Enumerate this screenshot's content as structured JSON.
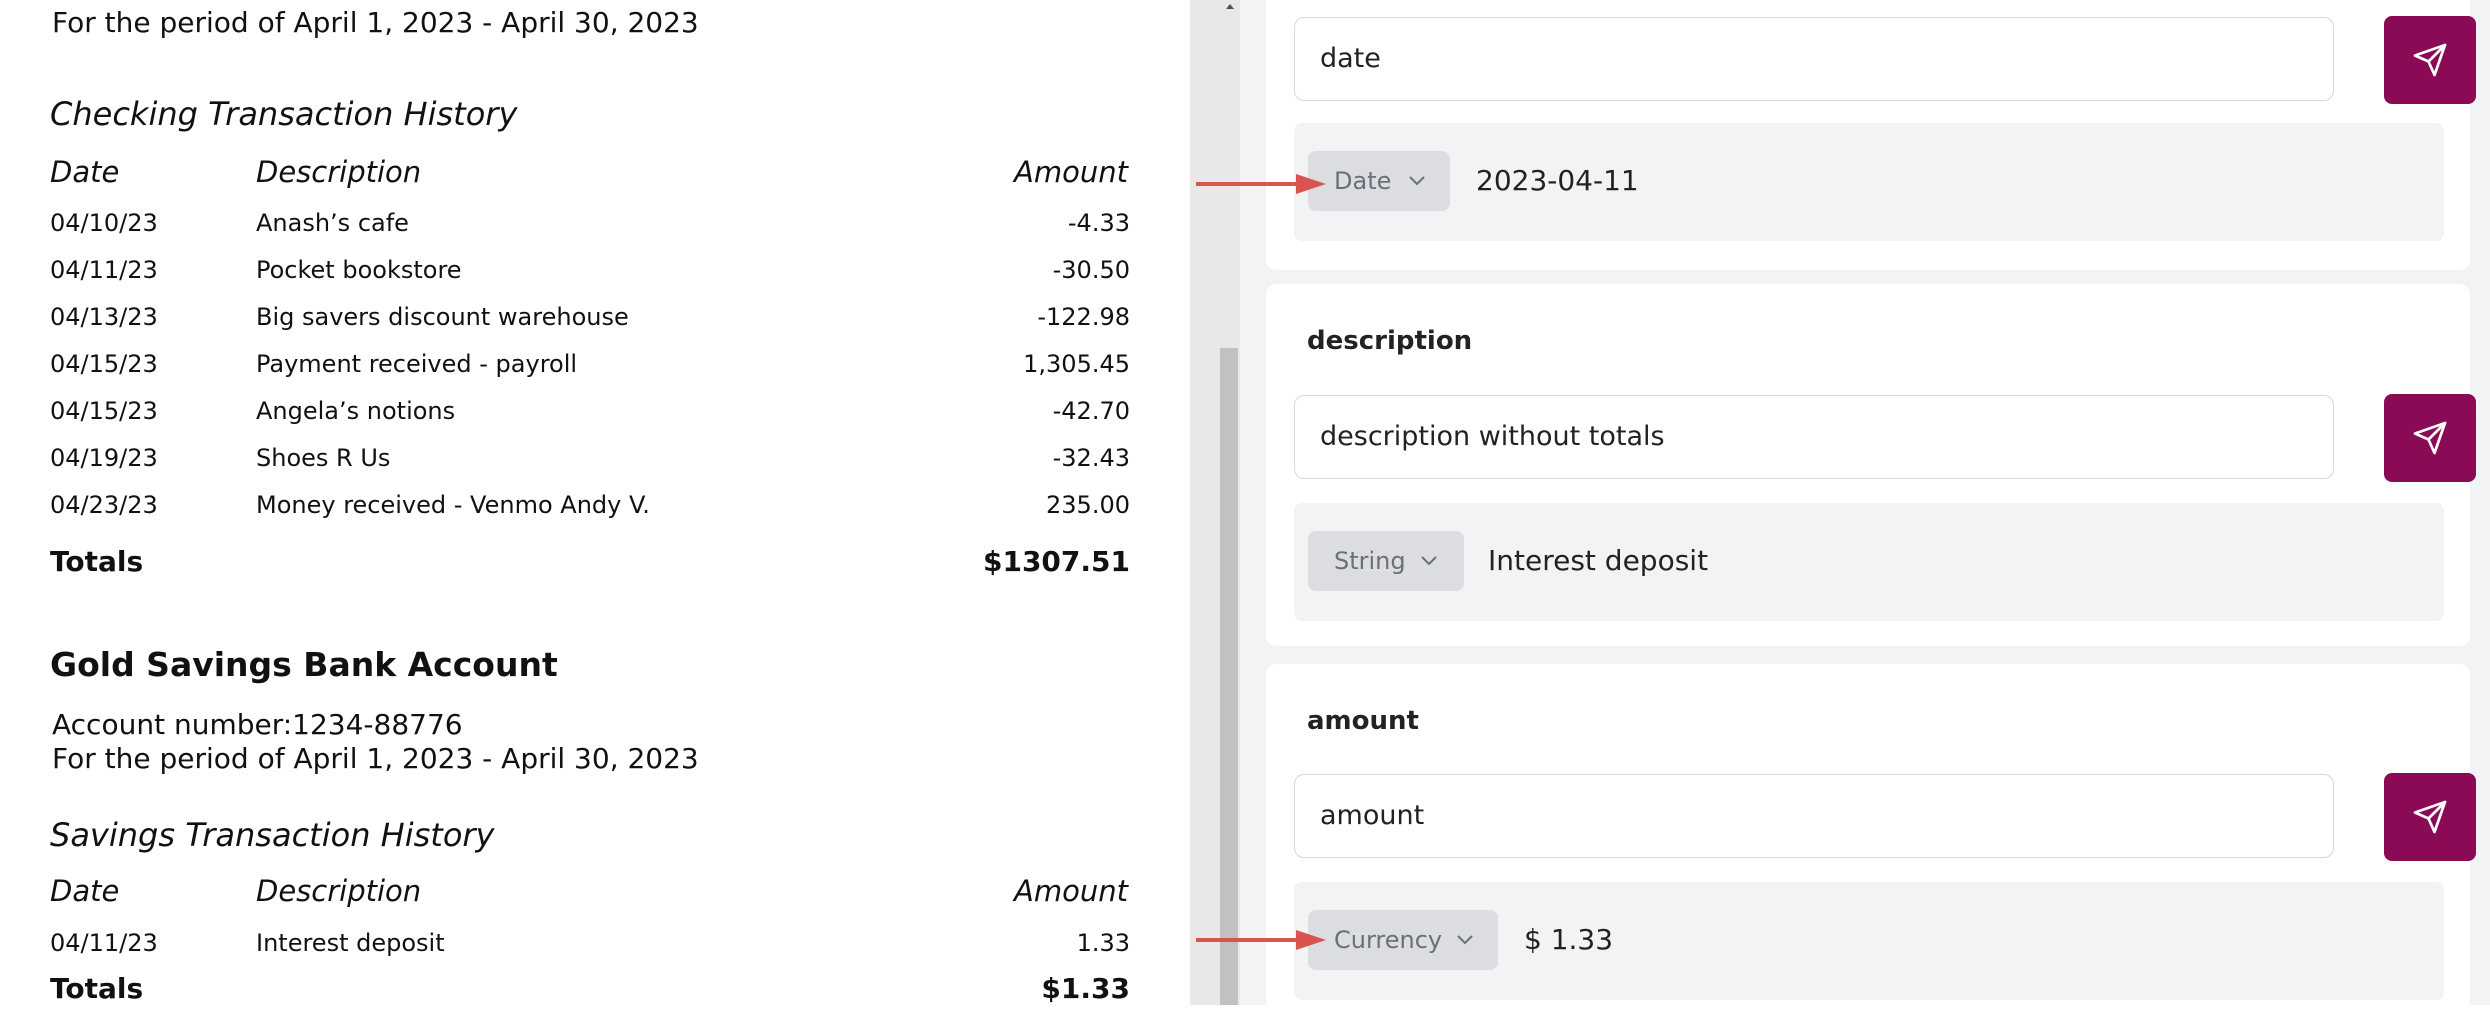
{
  "document": {
    "period_top": "For the period of April 1, 2023 - April 30, 2023",
    "checking": {
      "title": "Checking Transaction History",
      "headers": {
        "date": "Date",
        "description": "Description",
        "amount": "Amount"
      },
      "rows": [
        {
          "date": "04/10/23",
          "description": "Anash’s cafe",
          "amount": "-4.33"
        },
        {
          "date": "04/11/23",
          "description": "Pocket bookstore",
          "amount": "-30.50"
        },
        {
          "date": "04/13/23",
          "description": "Big savers discount warehouse",
          "amount": "-122.98"
        },
        {
          "date": "04/15/23",
          "description": "Payment received - payroll",
          "amount": "1,305.45"
        },
        {
          "date": "04/15/23",
          "description": "Angela’s notions",
          "amount": "-42.70"
        },
        {
          "date": "04/19/23",
          "description": "Shoes R Us",
          "amount": "-32.43"
        },
        {
          "date": "04/23/23",
          "description": "Money received - Venmo Andy V.",
          "amount": "235.00"
        }
      ],
      "totals_label": "Totals",
      "totals_value": "$1307.51"
    },
    "savings_account": {
      "title": "Gold Savings Bank Account",
      "account_number": "Account number:1234-88776",
      "period": "For the period of April 1, 2023 - April 30, 2023"
    },
    "savings": {
      "title": "Savings Transaction History",
      "headers": {
        "date": "Date",
        "description": "Description",
        "amount": "Amount"
      },
      "rows": [
        {
          "date": "04/11/23",
          "description": "Interest deposit",
          "amount": "1.33"
        }
      ],
      "totals_label": "Totals",
      "totals_value": "$1.33"
    }
  },
  "panel": {
    "date_field": {
      "input_value": "date",
      "type_label": "Date",
      "result_value": "2023-04-11",
      "send_icon": "send-icon"
    },
    "description_field": {
      "title": "description",
      "input_value": "description without totals",
      "type_label": "String",
      "result_value": "Interest deposit",
      "send_icon": "send-icon"
    },
    "amount_field": {
      "title": "amount",
      "input_value": "amount",
      "type_label": "Currency",
      "result_value": "$ 1.33",
      "send_icon": "send-icon"
    }
  },
  "colors": {
    "accent": "#8a0a55",
    "arrow": "#d9534f",
    "panel_bg": "#f2f3f5"
  }
}
